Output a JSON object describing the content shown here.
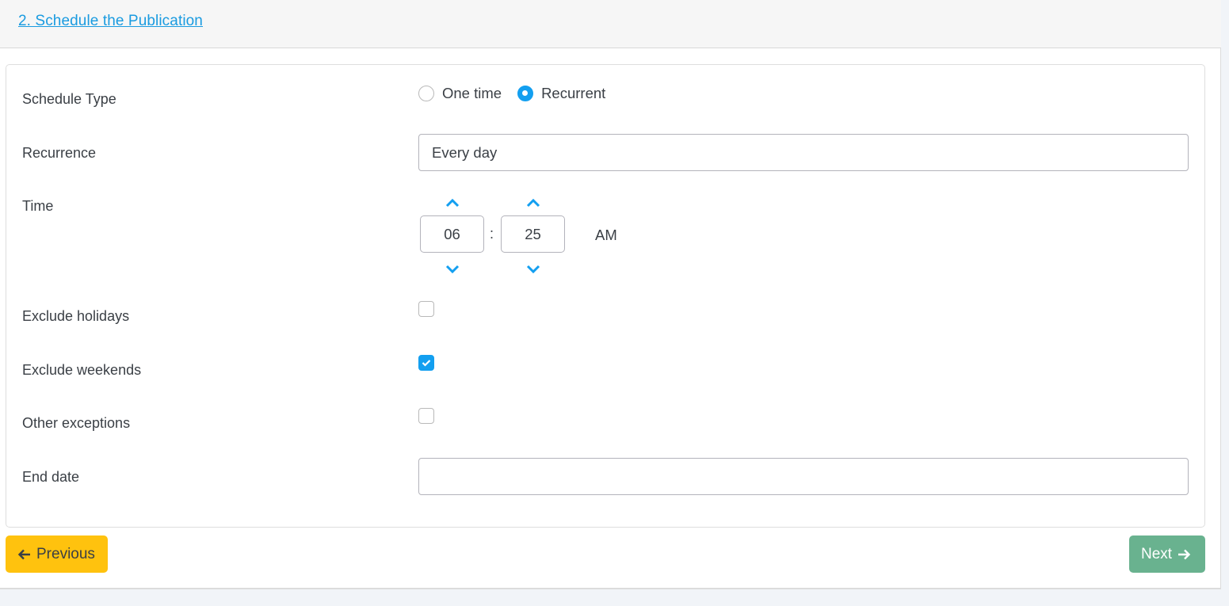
{
  "header": {
    "title": "2. Schedule the Publication"
  },
  "form": {
    "schedule_type": {
      "label": "Schedule Type",
      "options": [
        {
          "label": "One time",
          "checked": false
        },
        {
          "label": "Recurrent",
          "checked": true
        }
      ]
    },
    "recurrence": {
      "label": "Recurrence",
      "value": "Every day"
    },
    "time": {
      "label": "Time",
      "hours": "06",
      "minutes": "25",
      "separator": ":",
      "meridian": "AM"
    },
    "exclude_holidays": {
      "label": "Exclude holidays",
      "checked": false
    },
    "exclude_weekends": {
      "label": "Exclude weekends",
      "checked": true
    },
    "other_exceptions": {
      "label": "Other exceptions",
      "checked": false
    },
    "end_date": {
      "label": "End date",
      "value": ""
    }
  },
  "buttons": {
    "previous": {
      "label": "Previous",
      "icon": "arrow-left-icon"
    },
    "next": {
      "label": "Next",
      "icon": "arrow-right-icon"
    }
  },
  "colors": {
    "accent": "#139ff0",
    "link": "#1a9be0",
    "previous_button": "#ffc20e",
    "next_button": "#69b28f"
  }
}
